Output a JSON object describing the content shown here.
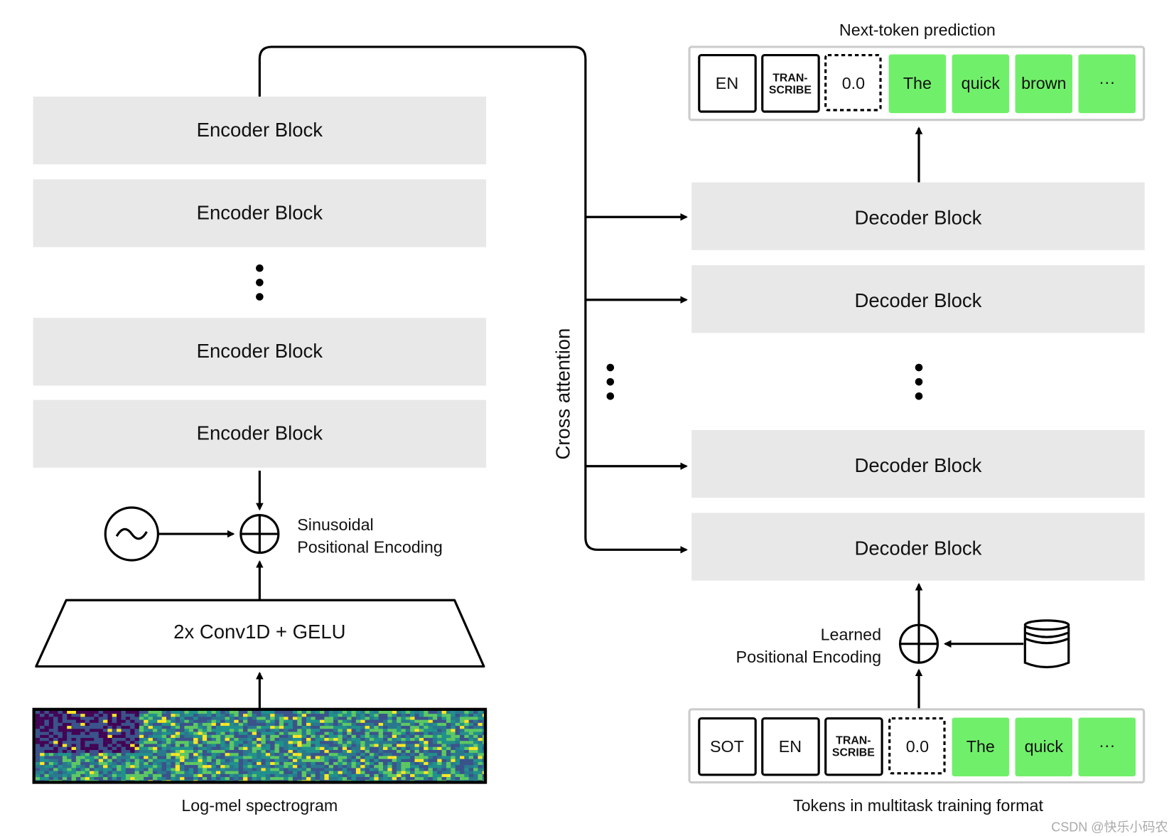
{
  "encoder": {
    "blocks": [
      "Encoder Block",
      "Encoder Block",
      "Encoder Block",
      "Encoder Block"
    ],
    "conv_label": "2x Conv1D + GELU",
    "pos_encoding_line1": "Sinusoidal",
    "pos_encoding_line2": "Positional Encoding",
    "spectrogram_caption": "Log-mel spectrogram"
  },
  "cross_attention_label": "Cross attention",
  "decoder": {
    "blocks": [
      "Decoder Block",
      "Decoder Block",
      "Decoder Block",
      "Decoder Block"
    ],
    "pos_encoding_line1": "Learned",
    "pos_encoding_line2": "Positional Encoding"
  },
  "output_tokens": {
    "title": "Next-token prediction",
    "tokens": [
      "EN",
      "TRAN-",
      "SCRIBE",
      "0.0",
      "The",
      "quick",
      "brown",
      "···"
    ]
  },
  "input_tokens": {
    "caption": "Tokens in multitask training format",
    "tokens": [
      "SOT",
      "EN",
      "TRAN-",
      "SCRIBE",
      "0.0",
      "The",
      "quick",
      "···"
    ]
  },
  "watermark": "CSDN @快乐小码农",
  "colors": {
    "block": "#e8e8e8",
    "token_green": "#70f06a",
    "frame": "#cccccc"
  }
}
